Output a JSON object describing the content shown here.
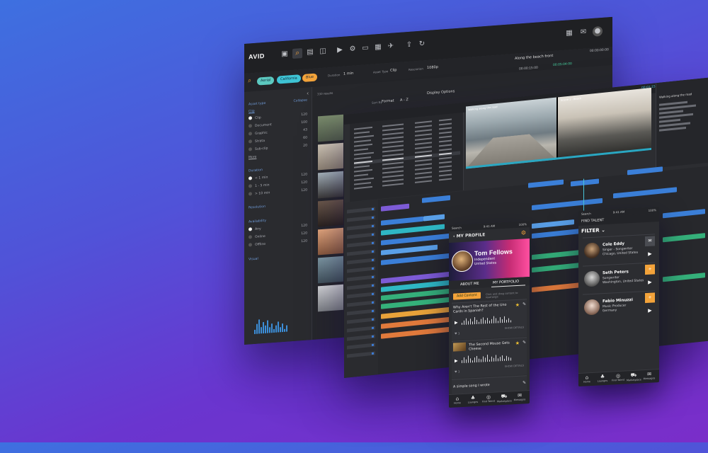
{
  "brand": "AVID",
  "back_window": {
    "filter_chips": [
      {
        "label": "Aerial",
        "color": "#5cc9c0"
      },
      {
        "label": "California",
        "color": "#3ec3d4"
      },
      {
        "label": "Blue",
        "color": "#f3a33a"
      }
    ],
    "toolbar": {
      "duration_label": "Duration",
      "duration_value": "1 min",
      "asset_type_label": "Asset Type",
      "asset_type_value": "Clip",
      "resolution_label": "Resolution",
      "resolution_value": "1080p",
      "sort_label": "Sort By",
      "sort_value": "Format",
      "sort_order": "A - Z",
      "display_options": "Display Options",
      "results": "330 results"
    },
    "preview_title": "Along the beach front",
    "timecodes": [
      "00:00:15:00",
      "00:05:04:00",
      "00:00:00:00"
    ],
    "sidebar": {
      "section_asset_type": "Asset type",
      "collapse": "Collapse",
      "asset_type_selected": "Clip",
      "asset_types": [
        {
          "label": "Clip",
          "count": "120",
          "on": true
        },
        {
          "label": "Document",
          "count": "100",
          "on": false
        },
        {
          "label": "Graphic",
          "count": "43",
          "on": false
        },
        {
          "label": "Strata",
          "count": "60",
          "on": false
        },
        {
          "label": "Sub-clip",
          "count": "20",
          "on": false
        }
      ],
      "more": "More",
      "section_duration": "Duration",
      "durations": [
        {
          "label": "< 1 min",
          "count": "120",
          "on": true
        },
        {
          "label": "1 - 5 min",
          "count": "120",
          "on": false
        },
        {
          "label": "> 10 min",
          "count": "120",
          "on": false
        }
      ],
      "section_resolution": "Resolution",
      "section_availability": "Availability",
      "availability": [
        {
          "label": "Any",
          "count": "120",
          "on": true
        },
        {
          "label": "Online",
          "count": "120",
          "on": false
        },
        {
          "label": "Offline",
          "count": "120",
          "on": false
        }
      ],
      "section_visual": "Visual"
    }
  },
  "mid_window": {
    "clip_name": "Walking along the road",
    "timecode": "00:01:15:22",
    "sequence": "Scene 1 - Beach",
    "inspector_title": "Walking along the road"
  },
  "profile_phone": {
    "status_left": "Search",
    "status_time": "9:41 AM",
    "status_right": "100%",
    "header": "MY PROFILE",
    "name": "Tom Fellows",
    "role": "Independent",
    "location": "United States",
    "tab_about": "ABOUT ME",
    "tab_portfolio": "MY PORTFOLIO",
    "add_button": "Add Content",
    "hint": "Click and drag content to rearrange",
    "songs": [
      {
        "title": "Why Aren't The Rest of the Uno Cards in Spanish?",
        "likes": "1",
        "details": "SHOW DETAILS"
      },
      {
        "title": "The Second Mouse Gets Cheese",
        "likes": "1",
        "details": "SHOW DETAILS"
      },
      {
        "title": "A simple song I wrote",
        "likes": "",
        "details": ""
      }
    ],
    "nav": [
      "Home",
      "Lounges",
      "Find Talent",
      "Marketplace",
      "Messages"
    ]
  },
  "talent_phone": {
    "header": "FIND TALENT",
    "filter": "FILTER",
    "people": [
      {
        "name": "Cole Eddy",
        "role": "Singer - Songwriter",
        "location": "Chicago, United States"
      },
      {
        "name": "Seth Peters",
        "role": "Songwriter",
        "location": "Washington, United States"
      },
      {
        "name": "Fabio Minuzzi",
        "role": "Music Producer",
        "location": "Germany"
      }
    ],
    "nav": [
      "Home",
      "Lounges",
      "Find Talent",
      "Marketplace",
      "Messages"
    ]
  },
  "colors": {
    "accent_orange": "#f3a33a",
    "teal": "#49c5d9",
    "clip_blue": "#3b7fd8",
    "clip_purple": "#7d5bd6",
    "clip_green": "#35b07a",
    "clip_orange": "#e07a3c"
  }
}
